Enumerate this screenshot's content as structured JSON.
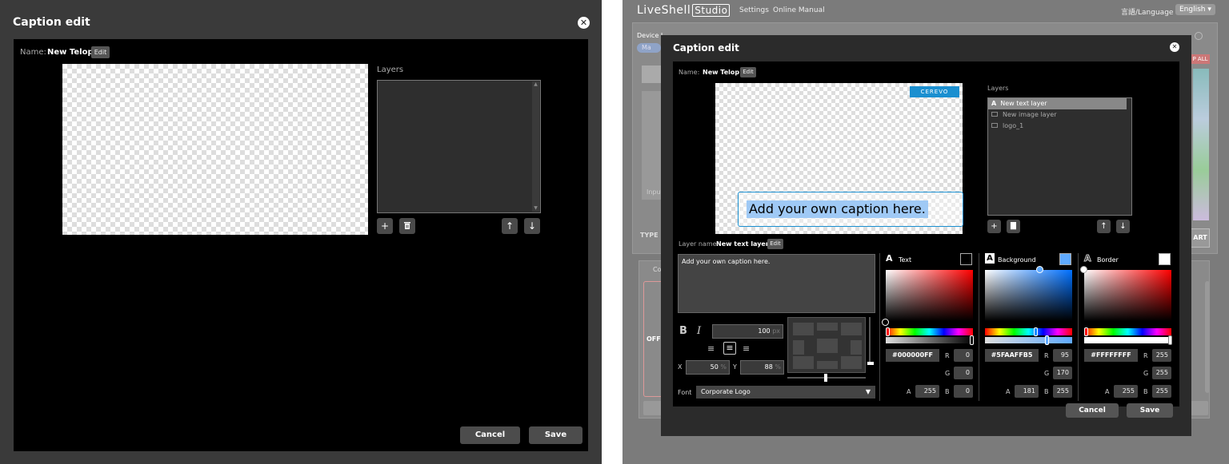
{
  "left": {
    "title": "Caption edit",
    "close_glyph": "✕",
    "name_label": "Name:",
    "name_value": "New Telop",
    "edit_label": "Edit",
    "layers_label": "Layers",
    "cancel_label": "Cancel",
    "save_label": "Save",
    "icons": [
      "plus-icon",
      "trash-icon",
      "arrow-up-icon",
      "arrow-down-icon",
      "close-icon"
    ]
  },
  "right": {
    "app_name": "LiveShell",
    "app_badge": "Studio",
    "nav": [
      "Settings",
      "Online Manual"
    ],
    "language_label": "言語/Language",
    "language_value": "English ▾",
    "bg": {
      "device": "Device I",
      "ma": "Ma",
      "input": "Input",
      "type": "TYPE",
      "stop_all": "P ALL",
      "art": "ART",
      "off": "OFF",
      "co": "Co"
    },
    "dialog": {
      "title": "Caption edit",
      "name_label": "Name:",
      "name_value": "New Telop",
      "edit_label": "Edit",
      "preview_badge": "CEREVO",
      "preview_caption": "Add your own caption here.",
      "layers_label": "Layers",
      "layers": [
        {
          "name": "New text layer",
          "icon": "text-layer-icon",
          "selected": true
        },
        {
          "name": "New image layer",
          "icon": "image-layer-icon",
          "selected": false
        },
        {
          "name": "logo_1",
          "icon": "image-layer-icon",
          "selected": false
        }
      ],
      "layer_name_label": "Layer name:",
      "layer_name_value": "New text layer",
      "text_content": "Add your own caption here.",
      "font_size": "100",
      "font_size_unit": "px",
      "x_label": "X",
      "x_value": "50",
      "y_label": "Y",
      "y_value": "88",
      "percent": "%",
      "font_label": "Font",
      "font_value": "Corporate Logo",
      "text_color": {
        "label": "Text",
        "hex": "#000000FF",
        "r": "0",
        "g": "0",
        "b": "0",
        "a": "255",
        "swatch": "#000000"
      },
      "background_color": {
        "label": "Background",
        "hex": "#5FAAFFB5",
        "r": "95",
        "g": "170",
        "b": "255",
        "a": "181",
        "swatch": "#5FAAFF"
      },
      "border_color": {
        "label": "Border",
        "hex": "#FFFFFFFF",
        "r": "255",
        "g": "255",
        "b": "255",
        "a": "255",
        "swatch": "#FFFFFF"
      },
      "r_label": "R",
      "g_label": "G",
      "b_label": "B",
      "a_label": "A",
      "cancel_label": "Cancel",
      "save_label": "Save"
    }
  }
}
